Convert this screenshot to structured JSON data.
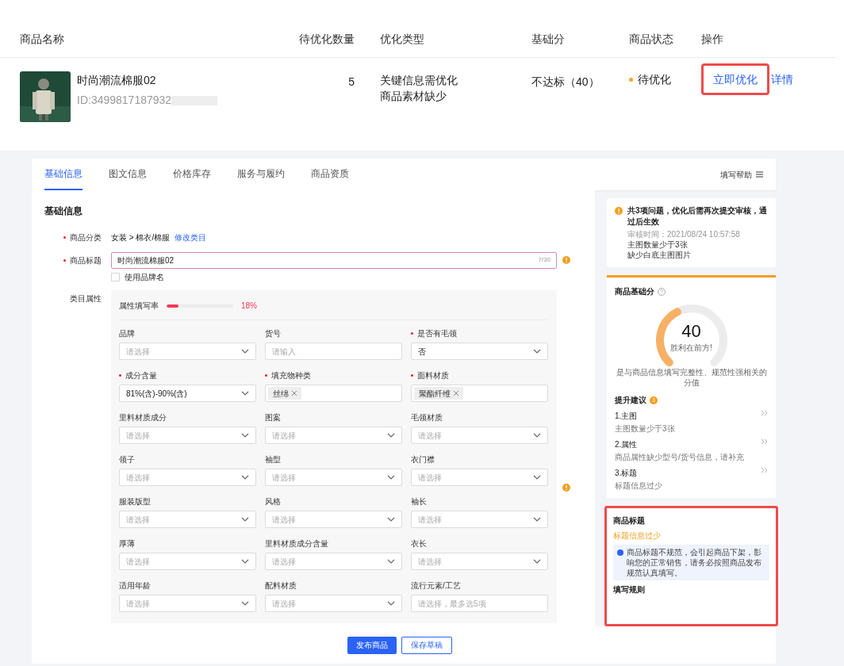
{
  "table": {
    "columns": [
      {
        "label": "商品名称"
      },
      {
        "label": "待优化数量"
      },
      {
        "label": "优化类型"
      },
      {
        "label": "基础分"
      },
      {
        "label": "商品状态"
      },
      {
        "label": "操作"
      }
    ],
    "rows": [
      {
        "name": "时尚潮流棉服02",
        "id": "ID:3499817187932",
        "count": "5",
        "types": [
          "关键信息需优化",
          "商品素材缺少"
        ],
        "score": "不达标（40）",
        "status": "待优化",
        "color": "#f5a623",
        "actions": [
          {
            "label": "立即优化",
            "highlighted": true
          },
          {
            "label": "详情",
            "highlighted": false
          }
        ]
      }
    ]
  },
  "tabs": [
    {
      "label": "基础信息",
      "selected": true
    },
    {
      "label": "图文信息",
      "selected": false
    },
    {
      "label": "价格库存",
      "selected": false
    },
    {
      "label": "服务与履约",
      "selected": false
    },
    {
      "label": "商品资质",
      "selected": false
    }
  ],
  "help": "填写帮助",
  "form": {
    "section": "基础信息",
    "category": {
      "label": "商品分类",
      "required": true,
      "value": "女装 > 棉衣/棉服",
      "link": "修改类目"
    },
    "title": {
      "label": "商品标题",
      "required": true,
      "value": "时尚潮流棉服02",
      "counter": "7/30",
      "warning": true
    },
    "brand_checkbox": {
      "label": "使用品牌名",
      "checked": false
    },
    "attributes": {
      "label": "类目属性",
      "fill_label": "属性填写率",
      "level": 0.18,
      "percent": "18%",
      "warning": true,
      "fields": [
        {
          "label": "品牌",
          "required": false,
          "kind": "select",
          "placeholder": "请选择"
        },
        {
          "label": "货号",
          "required": false,
          "kind": "input",
          "placeholder": "请输入"
        },
        {
          "label": "是否有毛领",
          "required": true,
          "kind": "select",
          "value": "否"
        },
        {
          "label": "成分含量",
          "required": true,
          "kind": "select",
          "value": "81%(含)-90%(含)"
        },
        {
          "label": "填充物种类",
          "required": true,
          "kind": "tags",
          "tags": [
            "丝绵"
          ]
        },
        {
          "label": "面料材质",
          "required": true,
          "kind": "tags",
          "tags": [
            "聚酯纤维"
          ]
        },
        {
          "label": "里料材质成分",
          "required": false,
          "kind": "select",
          "placeholder": "请选择"
        },
        {
          "label": "图案",
          "required": false,
          "kind": "select",
          "placeholder": "请选择"
        },
        {
          "label": "毛领材质",
          "required": false,
          "kind": "select",
          "placeholder": "请选择"
        },
        {
          "label": "领子",
          "required": false,
          "kind": "select",
          "placeholder": "请选择"
        },
        {
          "label": "袖型",
          "required": false,
          "kind": "select",
          "placeholder": "请选择"
        },
        {
          "label": "衣门襟",
          "required": false,
          "kind": "select",
          "placeholder": "请选择"
        },
        {
          "label": "服装版型",
          "required": false,
          "kind": "select",
          "placeholder": "请选择"
        },
        {
          "label": "风格",
          "required": false,
          "kind": "select",
          "placeholder": "请选择"
        },
        {
          "label": "袖长",
          "required": false,
          "kind": "select",
          "placeholder": "请选择"
        },
        {
          "label": "厚薄",
          "required": false,
          "kind": "select",
          "placeholder": "请选择"
        },
        {
          "label": "里料材质成分含量",
          "required": false,
          "kind": "select",
          "placeholder": "请选择"
        },
        {
          "label": "衣长",
          "required": false,
          "kind": "select",
          "placeholder": "请选择"
        },
        {
          "label": "适用年龄",
          "required": false,
          "kind": "select",
          "placeholder": "请选择"
        },
        {
          "label": "配料材质",
          "required": false,
          "kind": "select",
          "placeholder": "请选择"
        },
        {
          "label": "流行元素/工艺",
          "required": false,
          "kind": "input",
          "placeholder": "请选择，最多选5项"
        }
      ]
    }
  },
  "buttons": [
    {
      "label": "发布商品",
      "primary": true
    },
    {
      "label": "保存草稿",
      "primary": false
    }
  ],
  "sidebar": {
    "notice": {
      "title": "共3项问题，优化后需再次提交审核，通过后生效",
      "time": "审核时间：2021/08/24 10:57:58",
      "lines": [
        "主图数量少于3张",
        "缺少白底主图图片"
      ]
    },
    "score": {
      "title": "商品基础分",
      "value": "40",
      "caption": "胜利在前方!",
      "description": "是与商品信息填写完整性、规范性强相关的分值",
      "suggestions_title": "提升建议",
      "suggestions_count": "3",
      "suggestions": [
        {
          "title": "1.主图",
          "detail": "主图数量少于3张"
        },
        {
          "title": "2.属性",
          "detail": "商品属性缺少型号/货号信息，请补充"
        },
        {
          "title": "3.标题",
          "detail": "标题信息过少"
        }
      ]
    },
    "title_card": {
      "title": "商品标题",
      "warning": "标题信息过少",
      "info": "商品标题不规范，会引起商品下架，影响您的正常销售，请务必按照商品发布规范认真填写。",
      "rules": "填写规则",
      "highlighted": true
    }
  }
}
